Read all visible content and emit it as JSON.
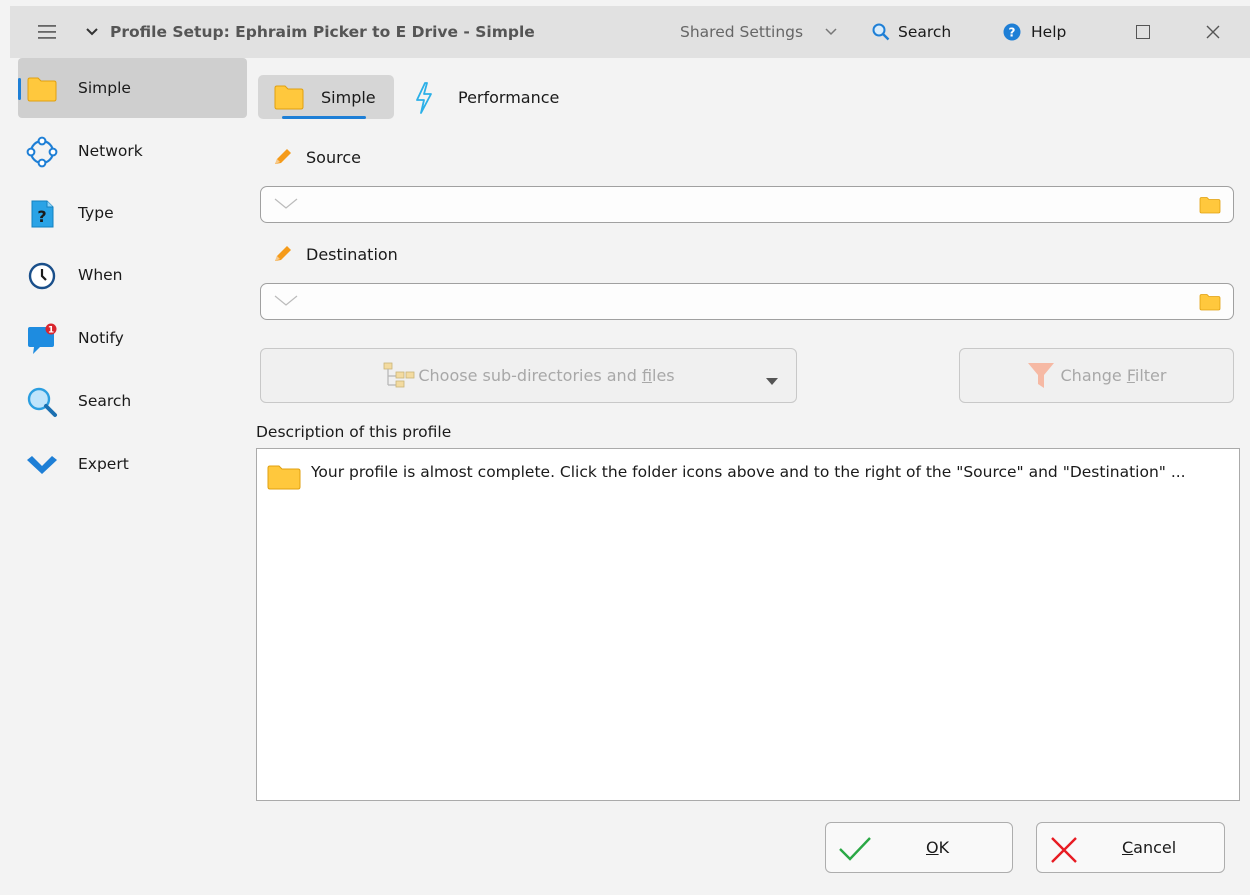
{
  "titlebar": {
    "title": "Profile Setup: Ephraim Picker to E Drive - Simple",
    "shared_settings": "Shared Settings",
    "search": "Search",
    "help": "Help"
  },
  "sidebar": {
    "items": [
      {
        "label": "Simple",
        "icon": "folder-icon"
      },
      {
        "label": "Network",
        "icon": "network-icon"
      },
      {
        "label": "Type",
        "icon": "question-icon"
      },
      {
        "label": "When",
        "icon": "clock-icon"
      },
      {
        "label": "Notify",
        "icon": "chat-badge-icon",
        "badge": "1"
      },
      {
        "label": "Search",
        "icon": "magnifier-icon"
      },
      {
        "label": "Expert",
        "icon": "chevron-check-icon"
      }
    ]
  },
  "tabs": {
    "simple": "Simple",
    "performance": "Performance"
  },
  "source": {
    "label": "Source",
    "value": ""
  },
  "destination": {
    "label": "Destination",
    "value": ""
  },
  "buttons": {
    "subdirs_prefix": "Choose sub-directories and ",
    "subdirs_mnemonic": "f",
    "subdirs_suffix": "iles",
    "filter_prefix": "Change ",
    "filter_mnemonic": "F",
    "filter_suffix": "ilter",
    "ok_mnemonic": "O",
    "ok_suffix": "K",
    "cancel_mnemonic": "C",
    "cancel_suffix": "ancel"
  },
  "description": {
    "label": "Description of this profile",
    "text": "Your profile is almost complete. Click the folder icons above and to the right of the \"Source\" and \"Destination\" ..."
  },
  "colors": {
    "accent": "#1e7fd6",
    "folder": "#ffc83d"
  }
}
